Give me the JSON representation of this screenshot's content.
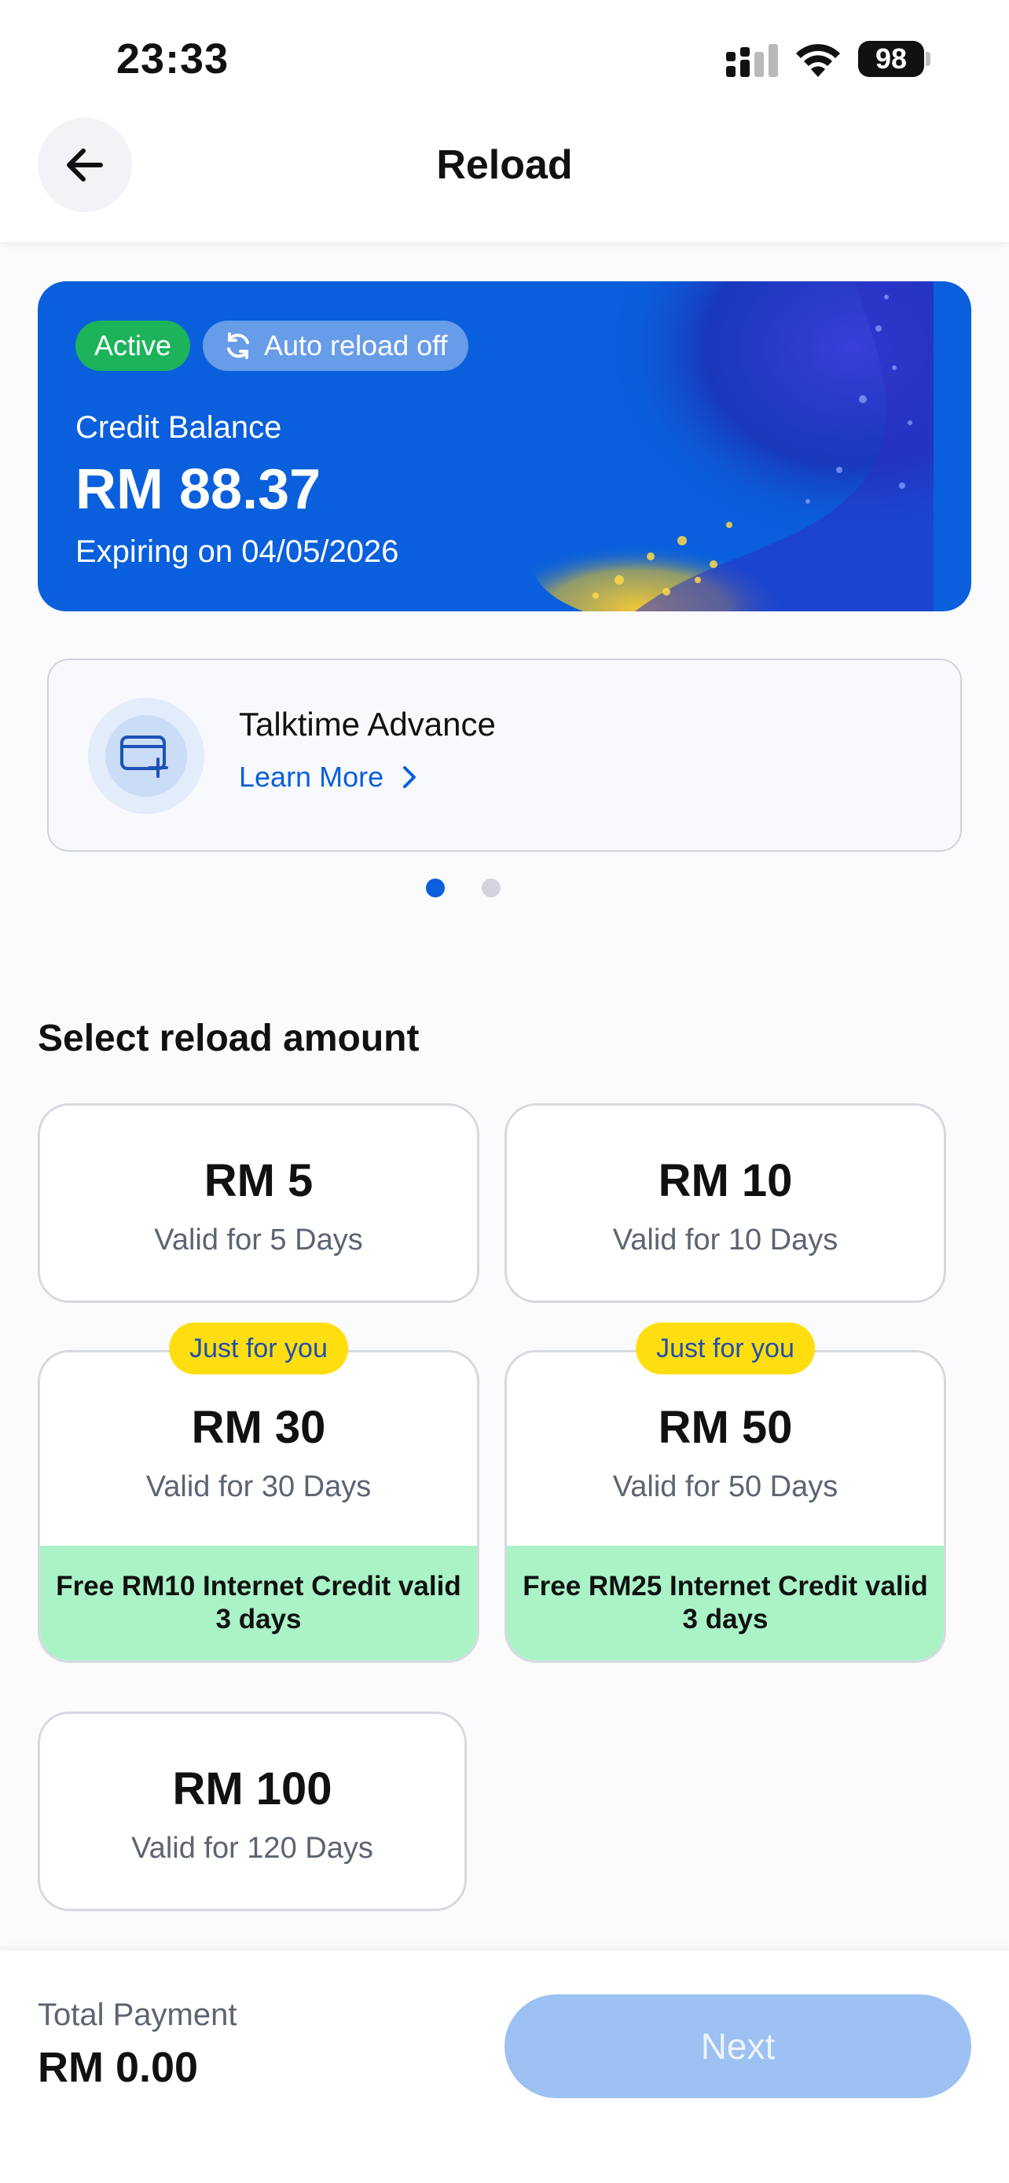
{
  "status_bar": {
    "time": "23:33",
    "battery": "98",
    "icons": [
      "cellular-signal-icon",
      "wifi-icon",
      "battery-icon"
    ]
  },
  "header": {
    "title": "Reload",
    "back_icon": "arrow-left-icon"
  },
  "balance_card": {
    "status": "Active",
    "auto_reload": "Auto reload off",
    "auto_reload_icon": "refresh-icon",
    "label": "Credit Balance",
    "amount": "RM 88.37",
    "expiry": "Expiring on 04/05/2026",
    "colors": {
      "card": "#0a5fdc",
      "active_badge": "#1cb35a"
    }
  },
  "promo": {
    "title": "Talktime Advance",
    "link": "Learn More",
    "icon": "card-add-icon",
    "link_icon": "chevron-right-icon"
  },
  "carousel": {
    "active_index": 1,
    "count": 2
  },
  "reload": {
    "section_title": "Select reload amount",
    "options": [
      {
        "amount": "RM 5",
        "validity": "Valid for 5 Days"
      },
      {
        "amount": "RM 10",
        "validity": "Valid for 10 Days"
      },
      {
        "amount": "RM 30",
        "validity": "Valid for 30 Days",
        "tag": "Just for you",
        "bonus": "Free RM10 Internet Credit valid 3 days"
      },
      {
        "amount": "RM 50",
        "validity": "Valid for 50 Days",
        "tag": "Just for you",
        "bonus": "Free RM25 Internet Credit valid 3 days"
      },
      {
        "amount": "RM 100",
        "validity": "Valid for 120 Days"
      }
    ]
  },
  "footer": {
    "total_label": "Total Payment",
    "total_amount": "RM 0.00",
    "next_label": "Next"
  }
}
